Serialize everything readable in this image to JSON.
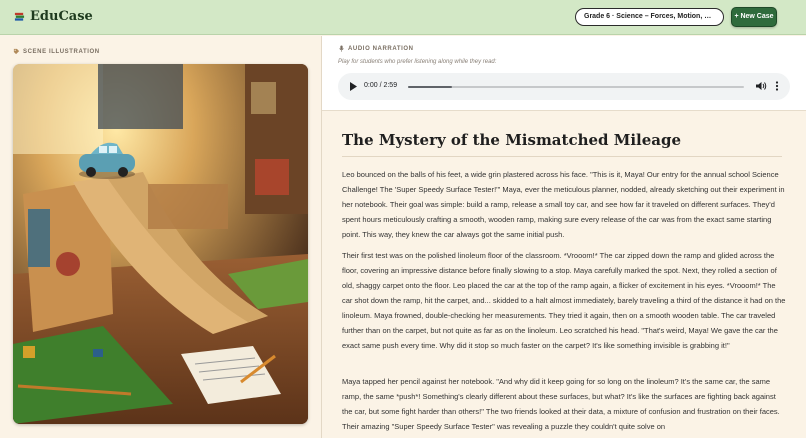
{
  "header": {
    "brand": "EduCase",
    "case_selector": "Grade 6 · Science – Forces, Motion, and Fri...",
    "new_case_label": "+ New Case"
  },
  "left": {
    "section_label": "SCENE ILLUSTRATION"
  },
  "audio": {
    "section_label": "AUDIO NARRATION",
    "subtitle": "Play for students who prefer listening along while they read:",
    "time": "0:00 / 2:59",
    "progress": 0.13
  },
  "story": {
    "title": "The Mystery of the Mismatched Mileage",
    "paragraphs": [
      "Leo bounced on the balls of his feet, a wide grin plastered across his face. \"This is it, Maya! Our entry for the annual school Science Challenge! The 'Super Speedy Surface Tester!'\" Maya, ever the meticulous planner, nodded, already sketching out their experiment in her notebook. Their goal was simple: build a ramp, release a small toy car, and see how far it traveled on different surfaces. They'd spent hours meticulously crafting a smooth, wooden ramp, making sure every release of the car was from the exact same starting point. This way, they knew the car always got the same initial push.",
      "Their first test was on the polished linoleum floor of the classroom. *Vrooom!* The car zipped down the ramp and glided across the floor, covering an impressive distance before finally slowing to a stop. Maya carefully marked the spot. Next, they rolled a section of old, shaggy carpet onto the floor. Leo placed the car at the top of the ramp again, a flicker of excitement in his eyes. *Vrooom!* The car shot down the ramp, hit the carpet, and... skidded to a halt almost immediately, barely traveling a third of the distance it had on the linoleum. Maya frowned, double-checking her measurements. They tried it again, then on a smooth wooden table. The car traveled further than on the carpet, but not quite as far as on the linoleum. Leo scratched his head. \"That's weird, Maya! We gave the car the exact same push every time. Why did it stop so much faster on the carpet? It's like something invisible is grabbing it!\"",
      "Maya tapped her pencil against her notebook. \"And why did it keep going for so long on the linoleum? It's the same car, the same ramp, the same *push*! Something's clearly different about these surfaces, but what? It's like the surfaces are fighting back against the car, but some fight harder than others!\" The two friends looked at their data, a mixture of confusion and frustration on their faces. Their amazing \"Super Speedy Surface Tester\" was revealing a puzzle they couldn't quite solve on"
    ]
  },
  "colors": {
    "header_bg": "#d3e8c6",
    "accent_green": "#2f6b3c",
    "page_bg": "#fbf3e6"
  }
}
